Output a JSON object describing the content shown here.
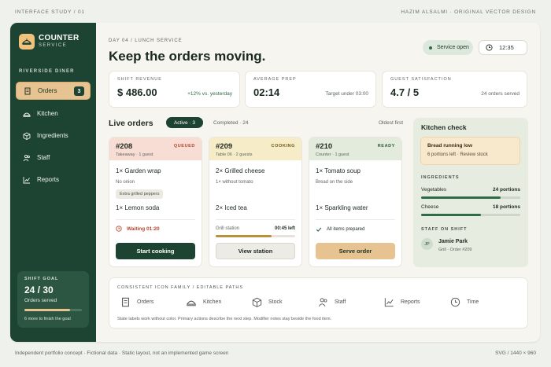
{
  "page": {
    "top_left": "INTERFACE STUDY / 01",
    "top_right": "HAZIM ALSALMI · ORIGINAL VECTOR DESIGN",
    "bottom_left": "Independent portfolio concept · Fictional data · Static layout, not an implemented game screen",
    "bottom_right": "SVG / 1440 × 960"
  },
  "sidebar": {
    "brand_title": "COUNTER",
    "brand_subtitle": "SERVICE",
    "section_label": "RIVERSIDE DINER",
    "items": [
      {
        "label": "Orders",
        "icon": "receipt-icon",
        "badge": "3",
        "active": true
      },
      {
        "label": "Kitchen",
        "icon": "cloche-icon"
      },
      {
        "label": "Ingredients",
        "icon": "box-icon"
      },
      {
        "label": "Staff",
        "icon": "people-icon"
      },
      {
        "label": "Reports",
        "icon": "chart-icon"
      }
    ],
    "goal": {
      "label": "SHIFT GOAL",
      "value": "24 / 30",
      "subtitle": "Orders served",
      "progress": 0.8,
      "note": "6 more to finish the goal"
    }
  },
  "header": {
    "eyebrow": "DAY 04 / LUNCH SERVICE",
    "title": "Keep the orders moving.",
    "service_status": "Service open",
    "time": "12:35"
  },
  "stats": [
    {
      "label": "SHIFT REVENUE",
      "value": "$ 486.00",
      "note": "+12% vs. yesterday"
    },
    {
      "label": "AVERAGE PREP",
      "value": "02:14",
      "note": "Target under 03:00"
    },
    {
      "label": "GUEST SATISFACTION",
      "value": "4.7 / 5",
      "note": "24 orders served"
    }
  ],
  "orders": {
    "title": "Live orders",
    "tab_active": "Active · 3",
    "tab_other": "Completed · 24",
    "sort_label": "Oldest first",
    "cards": [
      {
        "id": "#208",
        "status": "QUEUED",
        "meta": "Takeaway · 1 guest",
        "item1": "1× Garden wrap",
        "item1_note": "No onion",
        "item1_tag": "Extra grilled peppers",
        "item2": "1× Lemon soda",
        "footer": "Waiting 01:20",
        "action": "Start cooking",
        "colors": {
          "header": "#f7ddd3",
          "status": "#b8442d"
        }
      },
      {
        "id": "#209",
        "status": "COOKING",
        "meta": "Table 06 · 2 guests",
        "item1": "2× Grilled cheese",
        "item1_note": "1× without tomato",
        "item2": "2× Iced tea",
        "footer": "Grill station",
        "footer_value": "00:45 left",
        "progress": 0.7,
        "action": "View station",
        "colors": {
          "header": "#f7ecc8",
          "status": "#6b5a1a"
        }
      },
      {
        "id": "#210",
        "status": "READY",
        "meta": "Counter · 1 guest",
        "item1": "1× Tomato soup",
        "item1_note": "Bread on the side",
        "item2": "1× Sparkling water",
        "footer": "All items prepared",
        "action": "Serve order",
        "colors": {
          "header": "#e3ecdc",
          "status": "#2e5a3c"
        }
      }
    ]
  },
  "kitchen": {
    "title": "Kitchen check",
    "alert_title": "Bread running low",
    "alert_text": "6 portions left · Review stock",
    "ingredients_label": "INGREDIENTS",
    "ingredients": [
      {
        "name": "Vegetables",
        "value": "24 portions",
        "level": 0.8
      },
      {
        "name": "Cheese",
        "value": "18 portions",
        "level": 0.6
      }
    ],
    "staff_label": "STAFF ON SHIFT",
    "staff": {
      "initials": "JP",
      "name": "Jamie Park",
      "detail": "Grill · Order #209"
    }
  },
  "icon_family": {
    "title": "CONSISTENT ICON FAMILY / EDITABLE PATHS",
    "items": [
      {
        "label": "Orders",
        "icon": "receipt-icon"
      },
      {
        "label": "Kitchen",
        "icon": "cloche-icon"
      },
      {
        "label": "Stock",
        "icon": "box-icon"
      },
      {
        "label": "Staff",
        "icon": "people-icon"
      },
      {
        "label": "Reports",
        "icon": "chart-icon"
      },
      {
        "label": "Time",
        "icon": "clock-icon"
      }
    ],
    "footer": "State labels work without color. Primary actions describe the next step. Modifier notes stay beside the food item."
  },
  "colors": {
    "sidebar": "#1d4432",
    "accent": "#e6c390",
    "primary": "#1d4432",
    "alert": "#b8442d"
  }
}
